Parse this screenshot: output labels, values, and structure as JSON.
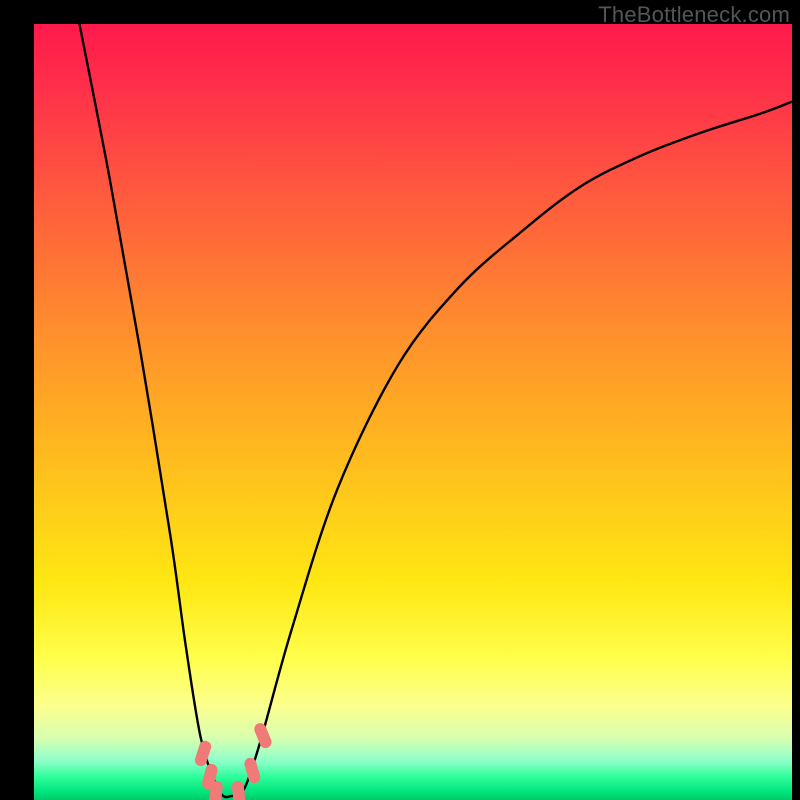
{
  "watermark": "TheBottleneck.com",
  "chart_data": {
    "type": "line",
    "title": "",
    "xlabel": "",
    "ylabel": "",
    "xlim": [
      0,
      100
    ],
    "ylim": [
      0,
      100
    ],
    "series": [
      {
        "name": "bottleneck-curve",
        "note": "V-shaped bottleneck curve; values are approximate percent of plot height read from the figure (0 = bottom, 100 = top).",
        "x": [
          6,
          10,
          14,
          18,
          20,
          22,
          24,
          25,
          26,
          27,
          28,
          30,
          34,
          40,
          48,
          56,
          64,
          72,
          80,
          88,
          96,
          100
        ],
        "values": [
          100,
          80,
          58,
          34,
          20,
          8,
          2,
          0.5,
          0.5,
          0.8,
          2,
          8,
          22,
          40,
          56,
          66,
          73,
          79,
          83,
          86,
          88.5,
          90
        ]
      }
    ],
    "markers": {
      "note": "Salmon rounded-rect markers near the curve minimum, positions as percent of plot area.",
      "points": [
        {
          "x": 22.3,
          "y": 6.0
        },
        {
          "x": 23.2,
          "y": 3.0
        },
        {
          "x": 24.0,
          "y": 0.8
        },
        {
          "x": 27.0,
          "y": 0.8
        },
        {
          "x": 28.8,
          "y": 3.8
        },
        {
          "x": 30.2,
          "y": 8.3
        }
      ]
    },
    "background_gradient": {
      "top": "#ff1a4b",
      "mid": "#ffe713",
      "bottom": "#00c96a"
    }
  }
}
